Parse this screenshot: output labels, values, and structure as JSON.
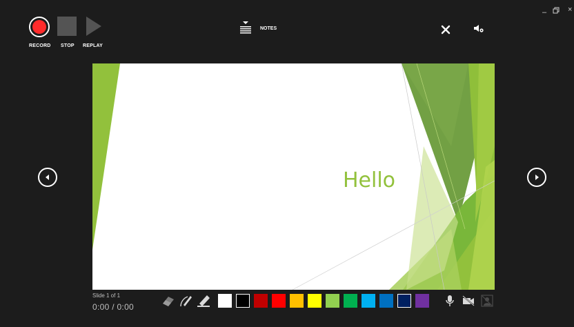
{
  "toolbar": {
    "record_label": "RECORD",
    "stop_label": "STOP",
    "replay_label": "REPLAY",
    "notes_label": "NOTES"
  },
  "window_controls": {
    "minimize": "–",
    "restore": "🗗",
    "close": "×"
  },
  "slide": {
    "title": "Hello",
    "counter": "Slide 1 of 1",
    "time": "0:00 / 0:00"
  },
  "pen_tools": [
    "eraser-icon",
    "pen-icon",
    "highlighter-icon"
  ],
  "colors": {
    "swatches": [
      "#ffffff",
      "#000000",
      "#c00000",
      "#ff0000",
      "#ffc000",
      "#ffff00",
      "#92d050",
      "#00b050",
      "#00b0f0",
      "#0070c0",
      "#002060",
      "#7030a0"
    ],
    "record_red": "#ff2b2b",
    "theme_green": "#92c13c"
  },
  "media_toggles": [
    "microphone-icon",
    "camera-off-icon",
    "camera-preview-off-icon"
  ]
}
